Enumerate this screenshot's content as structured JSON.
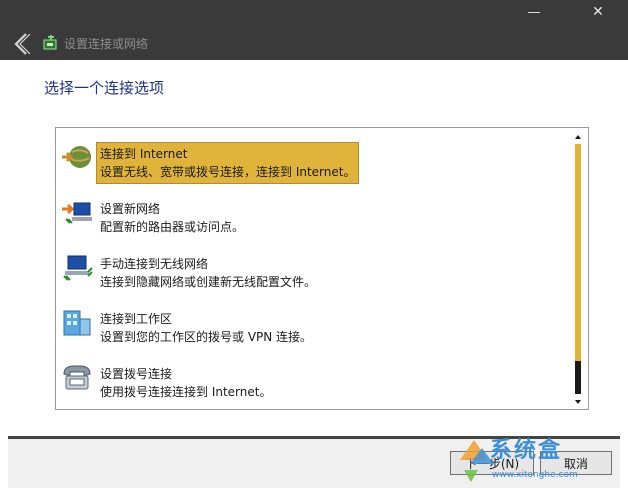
{
  "window": {
    "title": "设置连接或网络",
    "minimize_glyph": "—",
    "close_glyph": "✕"
  },
  "heading": "选择一个连接选项",
  "options": [
    {
      "title": "连接到 Internet",
      "description": "设置无线、宽带或拨号连接，连接到 Internet。",
      "icon": "globe-icon",
      "selected": true
    },
    {
      "title": "设置新网络",
      "description": "配置新的路由器或访问点。",
      "icon": "network-setup-icon",
      "selected": false
    },
    {
      "title": "手动连接到无线网络",
      "description": "连接到隐藏网络或创建新无线配置文件。",
      "icon": "wireless-computer-icon",
      "selected": false
    },
    {
      "title": "连接到工作区",
      "description": "设置到您的工作区的拨号或 VPN 连接。",
      "icon": "workplace-icon",
      "selected": false
    },
    {
      "title": "设置拨号连接",
      "description": "使用拨号连接连接到 Internet。",
      "icon": "dialup-phone-icon",
      "selected": false
    }
  ],
  "buttons": {
    "next": "下一步(N)",
    "cancel": "取消"
  },
  "watermark": {
    "text": "系统盒",
    "url": "www.xitonghe.com"
  },
  "colors": {
    "titlebar": "#3a3a3a",
    "heading": "#1e3287",
    "selection": "#e0b43b",
    "watermark": "#3f8fd6"
  }
}
